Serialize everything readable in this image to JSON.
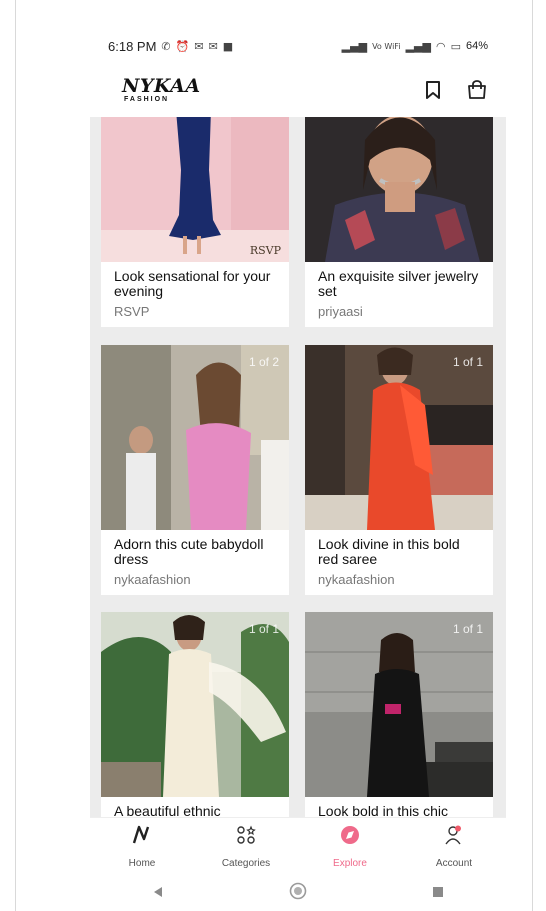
{
  "status_bar": {
    "time": "6:18 PM",
    "left_icons": [
      "wifi-calling-icon",
      "alarm-icon",
      "mail-icon",
      "mail-icon",
      "video-icon"
    ],
    "network_label": "Vo WiFi",
    "battery": "64%"
  },
  "header": {
    "logo_main": "NYKAA",
    "logo_sub": "FASHION"
  },
  "cards": [
    {
      "title": "Look sensational for your evening",
      "subtitle": "RSVP",
      "badge": "",
      "brand_mark": "RSVP"
    },
    {
      "title": "An exquisite silver jewelry set",
      "subtitle": "priyaasi",
      "badge": "",
      "brand_mark": ""
    },
    {
      "title": "Adorn this cute babydoll dress",
      "subtitle": "nykaafashion",
      "badge": "1 of 2",
      "brand_mark": ""
    },
    {
      "title": "Look divine in this bold red saree",
      "subtitle": "nykaafashion",
      "badge": "1 of 1",
      "brand_mark": ""
    },
    {
      "title": "A beautiful ethnic",
      "subtitle": "",
      "badge": "1 of 1",
      "brand_mark": ""
    },
    {
      "title": "Look bold in this chic",
      "subtitle": "",
      "badge": "1 of 1",
      "brand_mark": ""
    }
  ],
  "bottom_nav": [
    {
      "label": "Home",
      "icon": "nykaa-n-icon",
      "active": false
    },
    {
      "label": "Categories",
      "icon": "categories-grid-icon",
      "active": false
    },
    {
      "label": "Explore",
      "icon": "compass-icon",
      "active": true
    },
    {
      "label": "Account",
      "icon": "user-icon",
      "active": false
    }
  ],
  "colors": {
    "accent": "#ef6a8a",
    "feed_background": "#ececec"
  }
}
